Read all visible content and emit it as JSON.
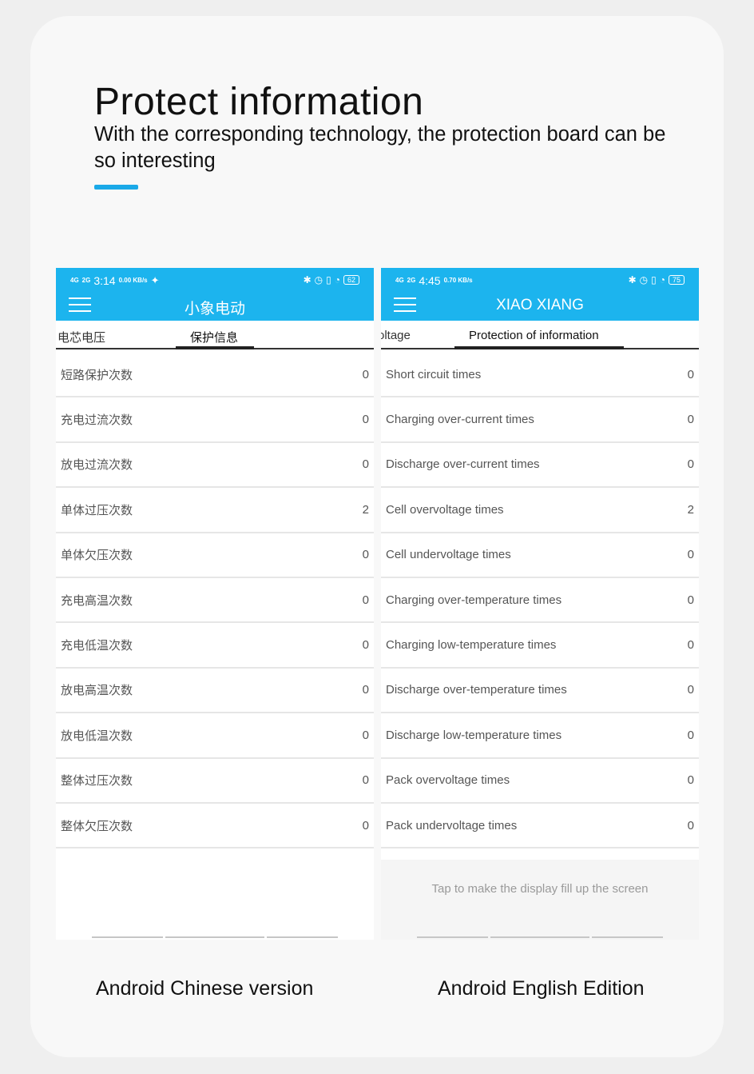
{
  "header": {
    "title": "Protect information",
    "subtitle": "With the corresponding technology, the protection board can be so interesting"
  },
  "colors": {
    "accent": "#1aa9e8",
    "appbar": "#1cb4ee"
  },
  "left_phone": {
    "status": {
      "signal1": "4G",
      "signal2": "2G",
      "time": "3:14",
      "speed": "0.00 KB/s",
      "battery": "62"
    },
    "app_title": "小象电动",
    "tabs": [
      "电芯电压",
      "保护信息"
    ],
    "rows": [
      {
        "label": "短路保护次数",
        "value": "0"
      },
      {
        "label": "充电过流次数",
        "value": "0"
      },
      {
        "label": "放电过流次数",
        "value": "0"
      },
      {
        "label": "单体过压次数",
        "value": "2"
      },
      {
        "label": "单体欠压次数",
        "value": "0"
      },
      {
        "label": "充电高温次数",
        "value": "0"
      },
      {
        "label": "充电低温次数",
        "value": "0"
      },
      {
        "label": "放电高温次数",
        "value": "0"
      },
      {
        "label": "放电低温次数",
        "value": "0"
      },
      {
        "label": "整体过压次数",
        "value": "0"
      },
      {
        "label": "整体欠压次数",
        "value": "0"
      }
    ],
    "caption": "Android Chinese version"
  },
  "right_phone": {
    "status": {
      "signal1": "4G",
      "signal2": "2G",
      "time": "4:45",
      "speed": "0.70 KB/s",
      "battery": "75"
    },
    "app_title": "XIAO XIANG",
    "tabs": [
      "oltage",
      "Protection of information"
    ],
    "rows": [
      {
        "label": "Short circuit times",
        "value": "0"
      },
      {
        "label": "Charging over-current times",
        "value": "0"
      },
      {
        "label": "Discharge over-current times",
        "value": "0"
      },
      {
        "label": "Cell overvoltage times",
        "value": "2"
      },
      {
        "label": "Cell undervoltage times",
        "value": "0"
      },
      {
        "label": "Charging over-temperature times",
        "value": "0"
      },
      {
        "label": "Charging low-temperature times",
        "value": "0"
      },
      {
        "label": "Discharge over-temperature times",
        "value": "0"
      },
      {
        "label": "Discharge low-temperature times",
        "value": "0"
      },
      {
        "label": "Pack overvoltage times",
        "value": "0"
      },
      {
        "label": "Pack undervoltage times",
        "value": "0"
      }
    ],
    "tap_hint": "Tap to make the display fill up the screen",
    "caption": "Android English Edition"
  }
}
